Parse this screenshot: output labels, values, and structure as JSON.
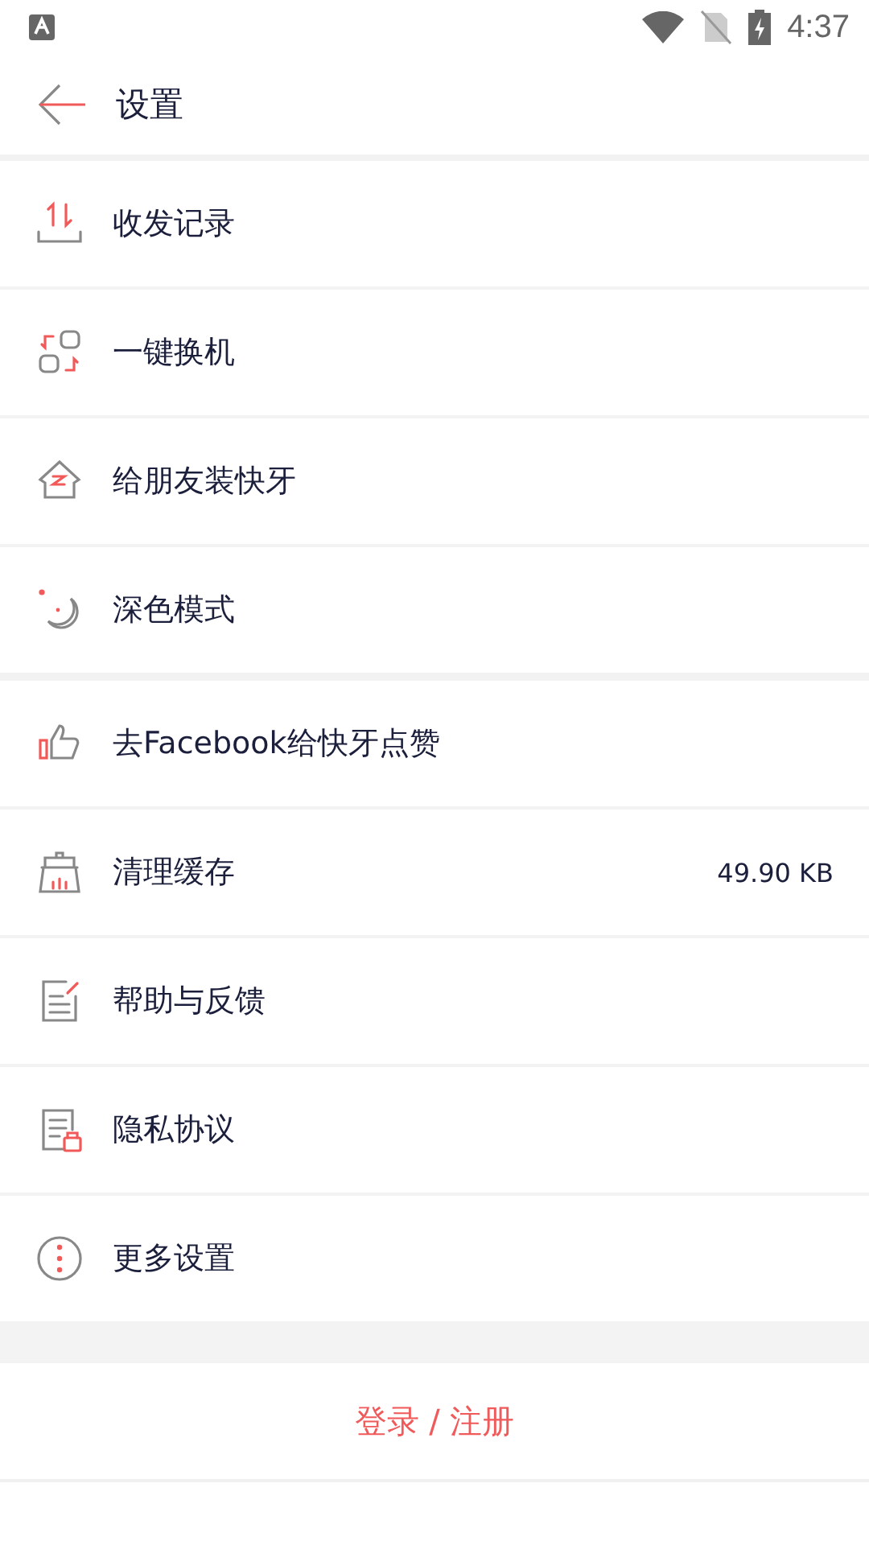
{
  "status_bar": {
    "time": "4:37"
  },
  "header": {
    "title": "设置"
  },
  "groups": [
    {
      "items": [
        {
          "label": "收发记录"
        },
        {
          "label": "一键换机"
        },
        {
          "label": "给朋友装快牙"
        },
        {
          "label": "深色模式"
        }
      ]
    },
    {
      "items": [
        {
          "label": "去Facebook给快牙点赞"
        },
        {
          "label": "清理缓存",
          "value": "49.90 KB"
        },
        {
          "label": "帮助与反馈"
        },
        {
          "label": "隐私协议"
        },
        {
          "label": "更多设置"
        }
      ]
    }
  ],
  "login_button": "登录 / 注册"
}
